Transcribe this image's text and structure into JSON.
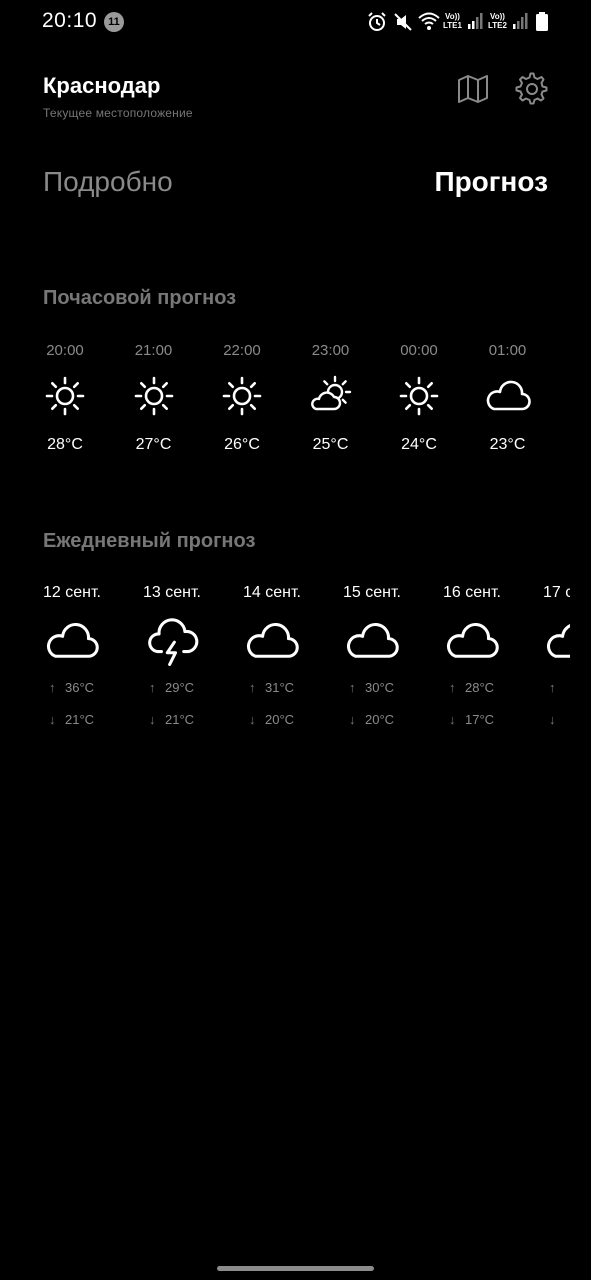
{
  "status_bar": {
    "time": "20:10",
    "notification_count": "11",
    "sim1_top": "Vo))",
    "sim1_bottom": "LTE1",
    "sim2_top": "Vo))",
    "sim2_bottom": "LTE2",
    "icons": [
      "alarm-icon",
      "mute-icon",
      "wifi-icon",
      "signal-icon",
      "signal-icon",
      "battery-icon"
    ]
  },
  "header": {
    "city": "Краснодар",
    "subtitle": "Текущее местоположение",
    "map_icon": "map-icon",
    "settings_icon": "gear-icon"
  },
  "tabs": {
    "detail": "Подробно",
    "forecast": "Прогноз",
    "active": "forecast"
  },
  "hourly": {
    "title": "Почасовой прогноз",
    "items": [
      {
        "time": "20:00",
        "icon": "sun-icon",
        "temp": "28°C"
      },
      {
        "time": "21:00",
        "icon": "sun-icon",
        "temp": "27°C"
      },
      {
        "time": "22:00",
        "icon": "sun-icon",
        "temp": "26°C"
      },
      {
        "time": "23:00",
        "icon": "partly-cloudy-icon",
        "temp": "25°C"
      },
      {
        "time": "00:00",
        "icon": "sun-icon",
        "temp": "24°C"
      },
      {
        "time": "01:00",
        "icon": "cloud-icon",
        "temp": "23°C"
      }
    ]
  },
  "daily": {
    "title": "Ежедневный прогноз",
    "items": [
      {
        "date": "12 сент.",
        "icon": "cloud-icon",
        "high": "36°C",
        "low": "21°C"
      },
      {
        "date": "13 сент.",
        "icon": "thunderstorm-icon",
        "high": "29°C",
        "low": "21°C"
      },
      {
        "date": "14 сент.",
        "icon": "cloud-icon",
        "high": "31°C",
        "low": "20°C"
      },
      {
        "date": "15 сент.",
        "icon": "cloud-icon",
        "high": "30°C",
        "low": "20°C"
      },
      {
        "date": "16 сент.",
        "icon": "cloud-icon",
        "high": "28°C",
        "low": "17°C"
      },
      {
        "date": "17 с",
        "icon": "cloud-icon",
        "high": "",
        "low": ""
      }
    ]
  },
  "arrows": {
    "up": "↑",
    "down": "↓"
  }
}
